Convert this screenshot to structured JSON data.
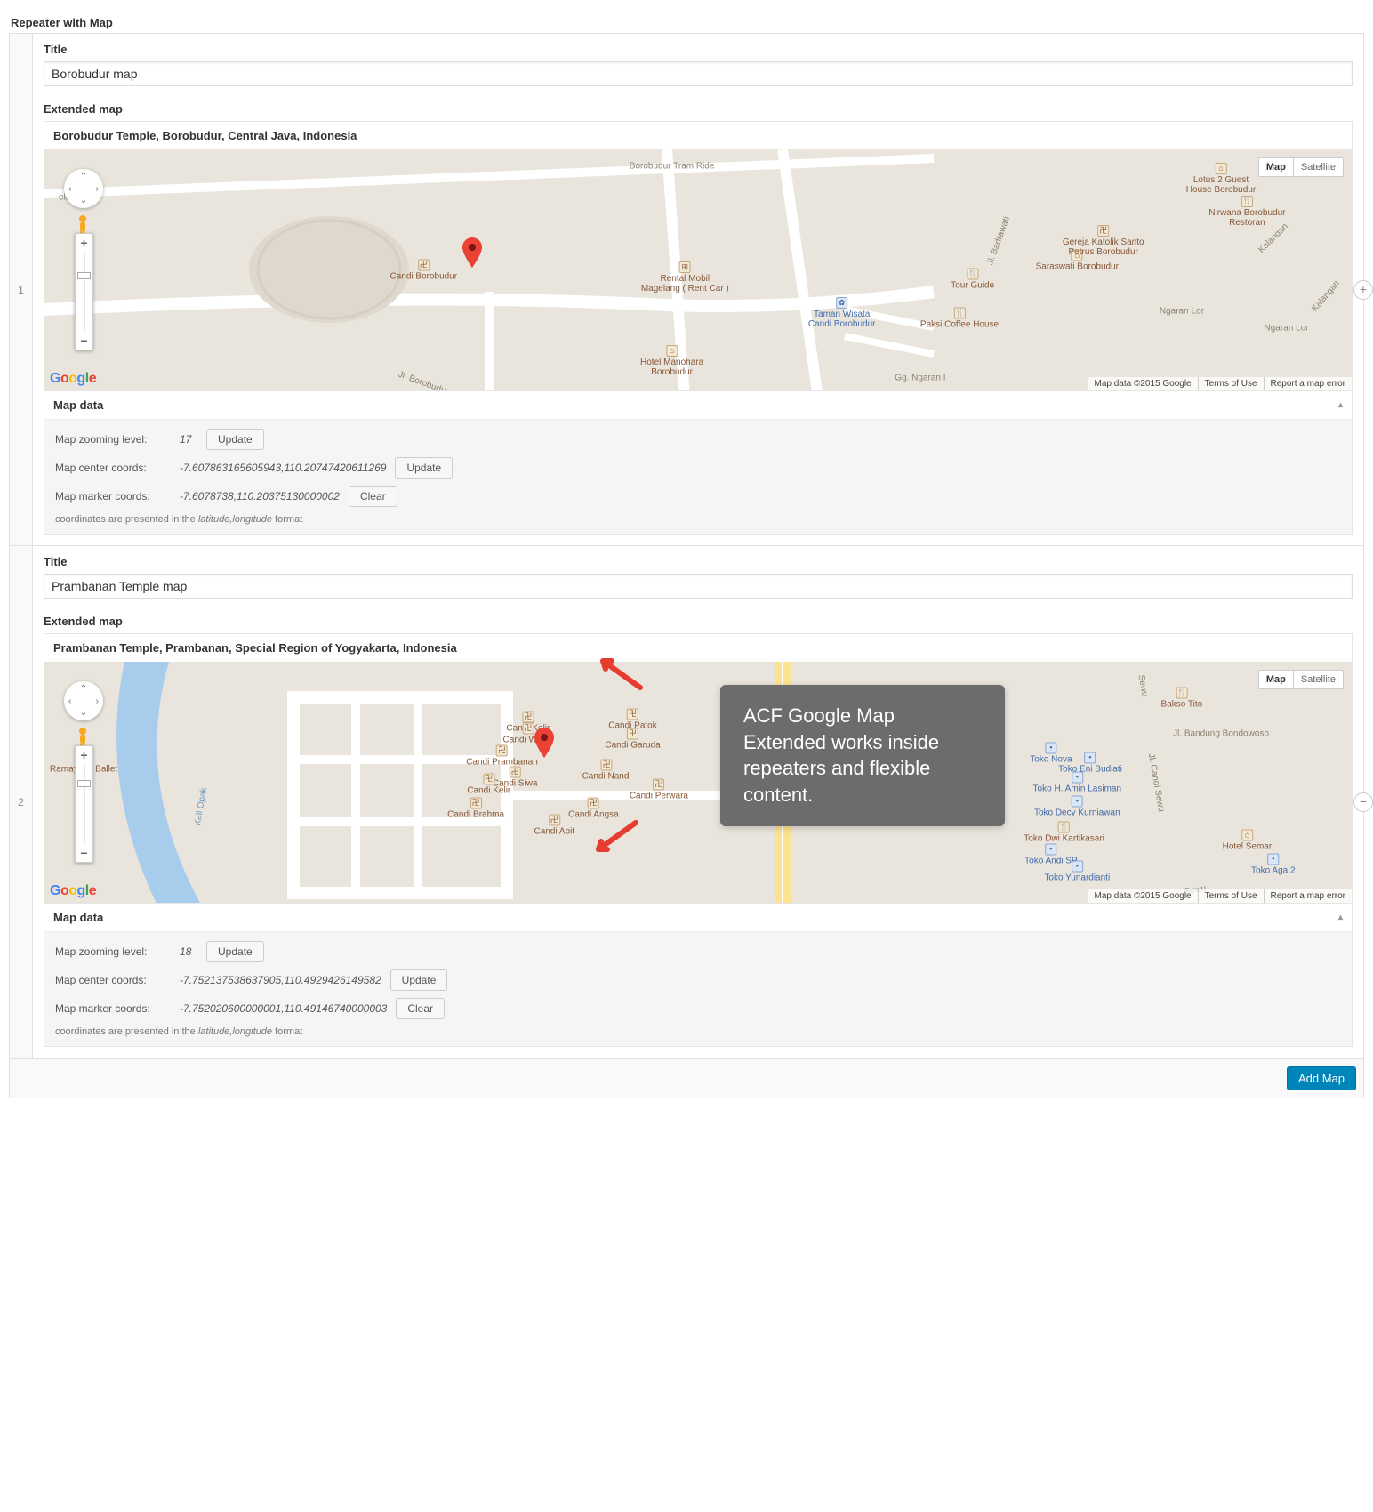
{
  "field_group_label": "Repeater with Map",
  "labels": {
    "title": "Title",
    "extended_map": "Extended map",
    "map_data": "Map data",
    "zoom": "Map zooming level:",
    "center": "Map center coords:",
    "marker": "Map marker coords:",
    "update": "Update",
    "clear": "Clear",
    "coords_note_prefix": "coordinates are presented in the ",
    "coords_note_italic": "latitude,longitude",
    "coords_note_suffix": " format"
  },
  "map_type": {
    "map": "Map",
    "satellite": "Satellite"
  },
  "attribution": {
    "copyright": "Map data ©2015 Google",
    "terms": "Terms of Use",
    "report": "Report a map error"
  },
  "add_button": "Add Map",
  "callout_text": "ACF Google Map Extended works inside repeaters and flexible content.",
  "rows": [
    {
      "index": "1",
      "title": "Borobudur map",
      "location": "Borobudur Temple, Borobudur, Central Java, Indonesia",
      "zoom": "17",
      "center": "-7.607863165605943,110.20747420611269",
      "marker_coords": "-7.6078738,110.20375130000002",
      "marker_pos": {
        "left": "32.7%",
        "top": "49%"
      },
      "slider_pos": "25%",
      "pois": [
        {
          "label": "Candi Borobudur",
          "top": "50%",
          "left": "29%",
          "type": "temple"
        },
        {
          "label": "Rental Mobil\nMagelang ( Rent Car )",
          "top": "53%",
          "left": "49%",
          "type": "car"
        },
        {
          "label": "Hotel Manohara\nBorobudur",
          "top": "88%",
          "left": "48%",
          "type": "hotel"
        },
        {
          "label": "Taman Wisata\nCandi Borobudur",
          "top": "68%",
          "left": "61%",
          "type": "park",
          "cls": "blue"
        },
        {
          "label": "Paksi Coffee House",
          "top": "70%",
          "left": "70%",
          "type": "food"
        },
        {
          "label": "Tour Guide",
          "top": "54%",
          "left": "71%",
          "type": "food"
        },
        {
          "label": "Saraswati Borobudur",
          "top": "46%",
          "left": "79%",
          "type": "hotel"
        },
        {
          "label": "Gereja Katolik Santo\nPetrus Borobudur",
          "top": "38%",
          "left": "81%",
          "type": "temple"
        },
        {
          "label": "Lotus 2 Guest\nHouse Borobudur",
          "top": "12%",
          "left": "90%",
          "type": "hotel"
        },
        {
          "label": "Nirwana Borobudur\nRestoran",
          "top": "26%",
          "left": "92%",
          "type": "food"
        }
      ],
      "roads": [
        {
          "label": "Borobudur Tram Ride",
          "top": "7%",
          "left": "48%"
        },
        {
          "label": "Jl. Badrawati",
          "top": "38%",
          "left": "73%",
          "rot": "-70"
        },
        {
          "label": "Kalangan",
          "top": "37%",
          "left": "94%",
          "rot": "-45"
        },
        {
          "label": "Ngaran Lor",
          "top": "74%",
          "left": "95%"
        },
        {
          "label": "Ngaran Lor",
          "top": "67%",
          "left": "87%"
        },
        {
          "label": "Gg. Ngaran I",
          "top": "95%",
          "left": "67%"
        },
        {
          "label": "Jl. Borobudur",
          "top": "97%",
          "left": "29%",
          "rot": "20"
        },
        {
          "label": "Kalangan",
          "top": "61%",
          "left": "98%",
          "rot": "-50"
        },
        {
          "label": "ellular",
          "top": "20%",
          "left": "2%"
        }
      ]
    },
    {
      "index": "2",
      "title": "Prambanan Temple map",
      "location": "Prambanan Temple, Prambanan, Special Region of Yogyakarta, Indonesia",
      "zoom": "18",
      "center": "-7.752137538637905,110.4929426149582",
      "marker_coords": "-7.752020600000001,110.49146740000003",
      "marker_pos": {
        "left": "38.2%",
        "top": "40%"
      },
      "slider_pos": "20%",
      "pois": [
        {
          "label": "Ramayana Ballet",
          "top": "42%",
          "left": "3%",
          "type": "theater"
        },
        {
          "label": "Candi Kelir",
          "top": "25%",
          "left": "37%",
          "type": "temple"
        },
        {
          "label": "Candi Wisnu",
          "top": "30%",
          "left": "37%",
          "type": "temple"
        },
        {
          "label": "Candi Patok",
          "top": "24%",
          "left": "45%",
          "type": "temple"
        },
        {
          "label": "Candi Garuda",
          "top": "32%",
          "left": "45%",
          "type": "temple"
        },
        {
          "label": "Candi Prambanan",
          "top": "39%",
          "left": "35%",
          "type": "temple"
        },
        {
          "label": "Candi Siwa",
          "top": "48%",
          "left": "36%",
          "type": "temple"
        },
        {
          "label": "Candi Nandi",
          "top": "45%",
          "left": "43%",
          "type": "temple"
        },
        {
          "label": "Candi Kelir",
          "top": "51%",
          "left": "34%",
          "type": "temple"
        },
        {
          "label": "Candi Perwara",
          "top": "53%",
          "left": "47%",
          "type": "temple"
        },
        {
          "label": "Candi Brahma",
          "top": "61%",
          "left": "33%",
          "type": "temple"
        },
        {
          "label": "Candi Angsa",
          "top": "61%",
          "left": "42%",
          "type": "temple"
        },
        {
          "label": "Candi Apit",
          "top": "68%",
          "left": "39%",
          "type": "temple"
        },
        {
          "label": "Bakso Tito",
          "top": "15%",
          "left": "87%",
          "type": "food"
        },
        {
          "label": "Toko Nova",
          "top": "38%",
          "left": "77%",
          "type": "shop",
          "cls": "blue"
        },
        {
          "label": "Toko Eni Budiati",
          "top": "42%",
          "left": "80%",
          "type": "shop",
          "cls": "blue"
        },
        {
          "label": "Toko H. Amin Lasiman",
          "top": "50%",
          "left": "79%",
          "type": "shop",
          "cls": "blue"
        },
        {
          "label": "Toko Decy Kurniawan",
          "top": "60%",
          "left": "79%",
          "type": "shop",
          "cls": "blue"
        },
        {
          "label": "Toko Dwi Kartikasari",
          "top": "71%",
          "left": "78%",
          "type": "food"
        },
        {
          "label": "Toko Andi SP",
          "top": "80%",
          "left": "77%",
          "type": "shop",
          "cls": "blue"
        },
        {
          "label": "Toko Yunardianti",
          "top": "87%",
          "left": "79%",
          "type": "shop",
          "cls": "blue"
        },
        {
          "label": "Hotel Semar",
          "top": "74%",
          "left": "92%",
          "type": "hotel"
        },
        {
          "label": "Toko Aga 2",
          "top": "84%",
          "left": "94%",
          "type": "shop",
          "cls": "blue"
        }
      ],
      "roads": [
        {
          "label": "Kali Opak",
          "top": "60%",
          "left": "12%",
          "rot": "-80",
          "cls": "water"
        },
        {
          "label": "Sewu",
          "top": "10%",
          "left": "84%",
          "rot": "80"
        },
        {
          "label": "Jl. Bandung Bondowoso",
          "top": "30%",
          "left": "90%"
        },
        {
          "label": "Jl. Candi Sewu",
          "top": "50%",
          "left": "85%",
          "rot": "80"
        },
        {
          "label": "Sewu",
          "top": "95%",
          "left": "88%",
          "rot": "-10"
        }
      ],
      "river": true
    }
  ]
}
